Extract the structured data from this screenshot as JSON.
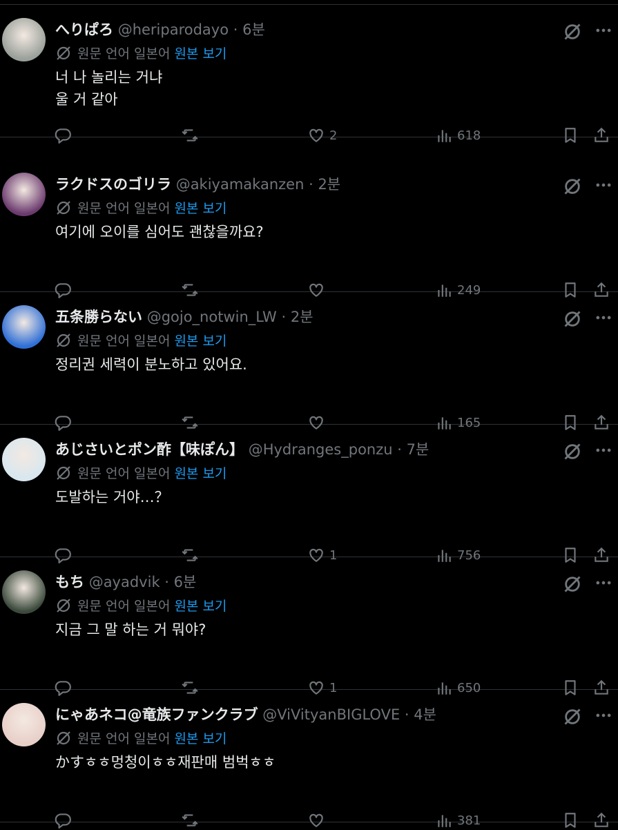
{
  "translation": {
    "label": "원문 언어 일본어",
    "link": "원본 보기"
  },
  "tweets": [
    {
      "display_name": "へりぱろ",
      "handle": "@heriparodayo",
      "time": "6분",
      "text": "너 나 놀리는 거냐\n울 거 같아",
      "likes": "2",
      "views": "618",
      "avatar": "#9aa09a"
    },
    {
      "display_name": "ラクドスのゴリラ",
      "handle": "@akiyamakanzen",
      "time": "2분",
      "text": "여기에 오이를 심어도 괜찮을까요?",
      "likes": "",
      "views": "249",
      "avatar": "#6b3a6e"
    },
    {
      "display_name": "五条勝らない",
      "handle": "@gojo_notwin_LW",
      "time": "2분",
      "text": "정리권 세력이 분노하고 있어요.",
      "likes": "",
      "views": "165",
      "avatar": "#2f6fd6"
    },
    {
      "display_name": "あじさいとポン酢【味ぽん】",
      "handle": "@Hydranges_ponzu",
      "time": "7분",
      "text": "도발하는 거야…？",
      "likes": "1",
      "views": "756",
      "avatar": "#d8e7ef"
    },
    {
      "display_name": "もち",
      "handle": "@ayadvik",
      "time": "6분",
      "text": "지금 그 말 하는 거 뭐야?",
      "likes": "1",
      "views": "650",
      "avatar": "#3b4a3c"
    },
    {
      "display_name": "にゃあネコ@竜族ファンクラブ",
      "handle": "@ViVityanBIGLOVE",
      "time": "4분",
      "text": "かすㅎㅎ멍청이ㅎㅎ재판매 범벅ㅎㅎ",
      "likes": "",
      "views": "381",
      "avatar": "#e8cfc8"
    }
  ]
}
